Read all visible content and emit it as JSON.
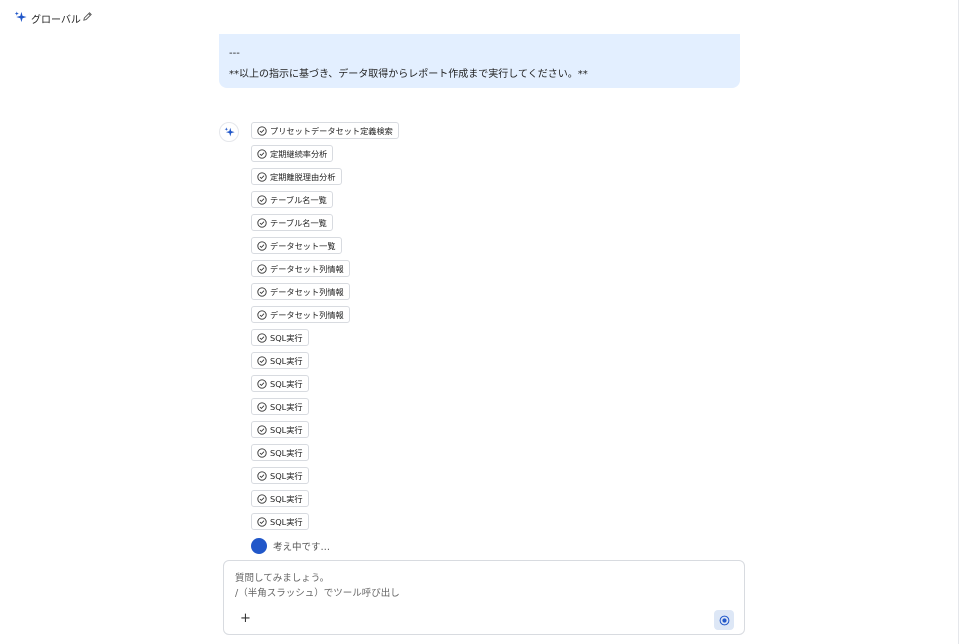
{
  "header": {
    "title": "グローバル",
    "icons": [
      "sparkle-icon",
      "pencil-icon"
    ]
  },
  "conversation": {
    "user_message": {
      "line1": "---",
      "line2": "**以上の指示に基づき、データ取得からレポート作成まで実行してください。**"
    },
    "tool_calls": [
      "プリセットデータセット定義検索",
      "定期継続率分析",
      "定期離脱理由分析",
      "テーブル名一覧",
      "テーブル名一覧",
      "データセット一覧",
      "データセット列情報",
      "データセット列情報",
      "データセット列情報",
      "SQL実行",
      "SQL実行",
      "SQL実行",
      "SQL実行",
      "SQL実行",
      "SQL実行",
      "SQL実行",
      "SQL実行",
      "SQL実行"
    ],
    "status": "考え中です…"
  },
  "composer": {
    "placeholder_line1": "質問してみましょう。",
    "placeholder_line2": "/（半角スラッシュ）でツール呼び出し",
    "add_label": "+",
    "accent": "#2157c9"
  }
}
